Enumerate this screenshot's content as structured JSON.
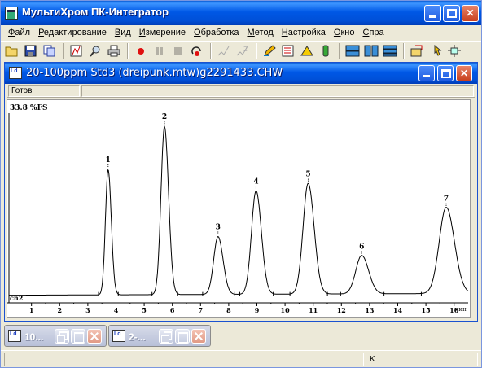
{
  "app": {
    "title": "МультиХром ПК-Интегратор",
    "minimize_label": "_",
    "close_label": "✕"
  },
  "menu": [
    {
      "label": "Файл"
    },
    {
      "label": "Редактирование"
    },
    {
      "label": "Вид"
    },
    {
      "label": "Измерение"
    },
    {
      "label": "Обработка"
    },
    {
      "label": "Метод"
    },
    {
      "label": "Настройка"
    },
    {
      "label": "Окно"
    },
    {
      "label": "Спра"
    }
  ],
  "toolbar": {
    "icons": [
      "open-folder-icon",
      "save-icon",
      "copy-icon",
      "report-icon",
      "search-icon",
      "print-icon",
      "record-icon",
      "pause-icon",
      "stop-icon",
      "start-icon",
      "integrate-icon",
      "integrate-2-icon",
      "edit-icon",
      "calibration-icon",
      "peak-icon",
      "vial-icon",
      "tile-horizontal-icon",
      "tile-vertical-icon",
      "tile-stack-icon",
      "export-icon",
      "cursor-icon",
      "zoom-fit-icon"
    ]
  },
  "document": {
    "title": "20-100ppm Std3 (dreipunk.mtw)g2291433.CHW",
    "status": "Готов",
    "channel_label": "ch2",
    "fullscale_label": "33.8 %FS",
    "x_unit_label": "мин"
  },
  "chart_data": {
    "type": "line",
    "title": "",
    "xlabel": "мин",
    "ylabel": "",
    "xlim": [
      0.2,
      16.5
    ],
    "ylim": [
      0,
      33.8
    ],
    "x_ticks": [
      "1",
      "2",
      "3",
      "4",
      "5",
      "6",
      "7",
      "8",
      "9",
      "10",
      "11",
      "12",
      "13",
      "14",
      "15",
      "16"
    ],
    "grid": false,
    "peaks": [
      {
        "label": "1",
        "rt": 3.72,
        "height": 22.5,
        "width": 0.1
      },
      {
        "label": "2",
        "rt": 5.72,
        "height": 30.2,
        "width": 0.13
      },
      {
        "label": "3",
        "rt": 7.62,
        "height": 10.4,
        "width": 0.16
      },
      {
        "label": "4",
        "rt": 8.97,
        "height": 18.6,
        "width": 0.17
      },
      {
        "label": "5",
        "rt": 10.82,
        "height": 19.9,
        "width": 0.19
      },
      {
        "label": "6",
        "rt": 12.72,
        "height": 6.9,
        "width": 0.22
      },
      {
        "label": "7",
        "rt": 15.72,
        "height": 15.5,
        "width": 0.26
      }
    ]
  },
  "minimized": [
    {
      "title": "10..."
    },
    {
      "title": "2-..."
    }
  ],
  "statusbar": {
    "left": "",
    "right": "K"
  }
}
